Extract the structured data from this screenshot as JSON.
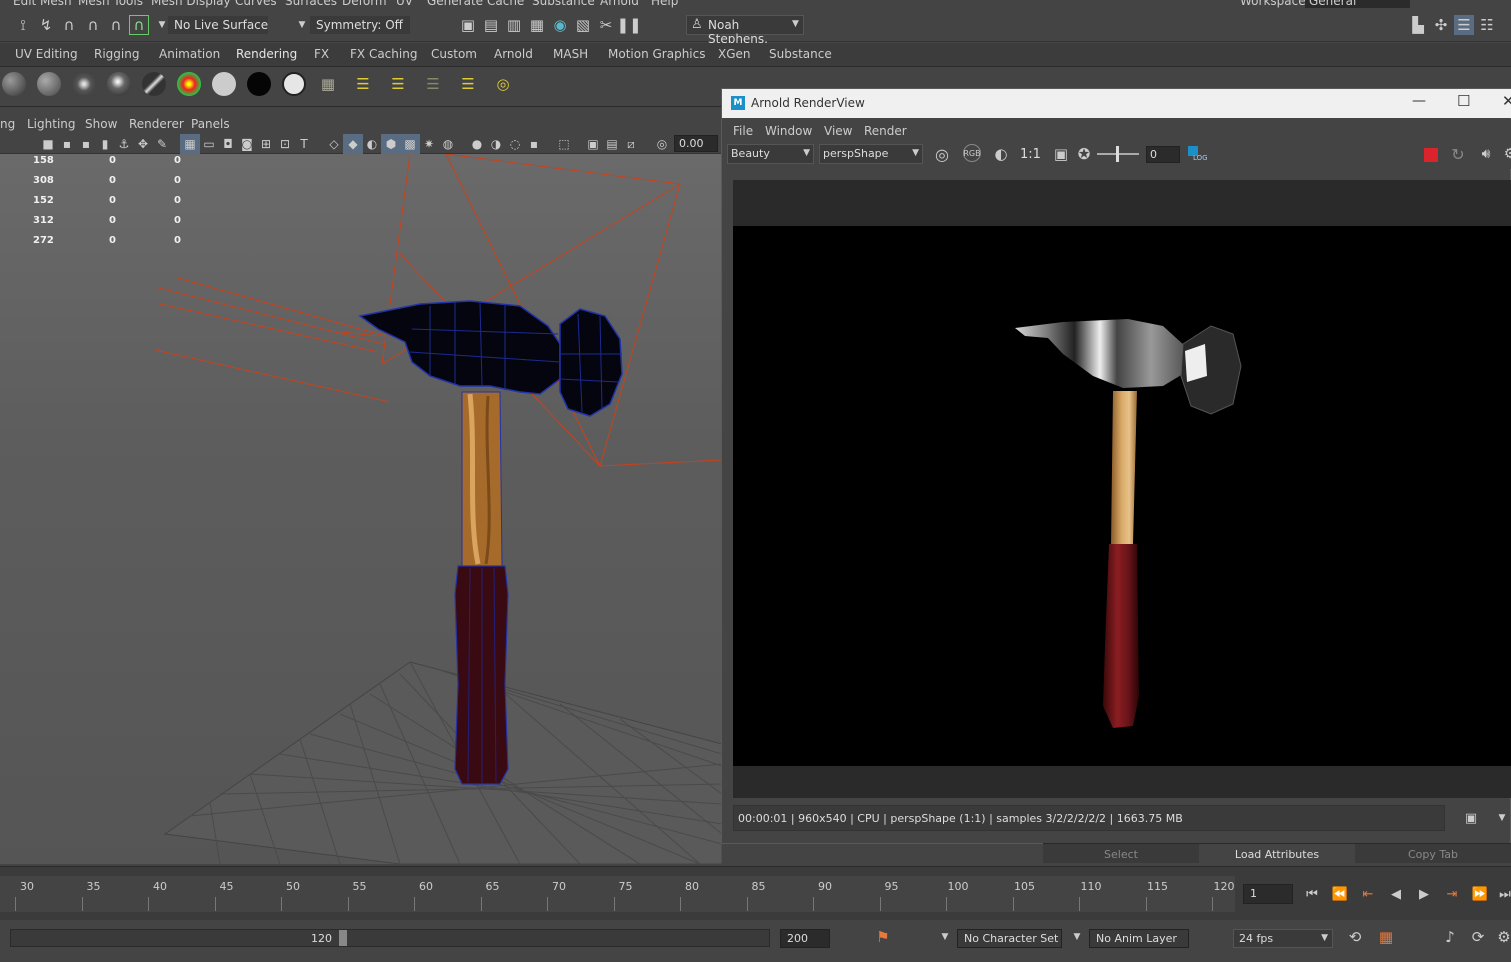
{
  "menubar": {
    "items": [
      "Edit Mesh",
      "Mesh Tools",
      "Mesh Display",
      "Curves",
      "Surfaces",
      "Deform",
      "UV",
      "Generate",
      "Cache",
      "Substance",
      "Arnold",
      "Help"
    ],
    "workspace_label": "Workspace:",
    "workspace_value": "General"
  },
  "statusline": {
    "live_surface": "No Live Surface",
    "symmetry": "Symmetry: Off",
    "user": "Noah Stephens."
  },
  "shelf": {
    "tabs": [
      "UV Editing",
      "Rigging",
      "Animation",
      "Rendering",
      "FX",
      "FX Caching",
      "Custom",
      "Arnold",
      "MASH",
      "Motion Graphics",
      "XGen",
      "Substance"
    ],
    "active_tab": "Rendering"
  },
  "panel": {
    "menus": [
      "ng",
      "Lighting",
      "Show",
      "Renderer",
      "Panels"
    ],
    "exposure_value": "0.00"
  },
  "hud_rows": [
    [
      "158",
      "0",
      "0"
    ],
    [
      "308",
      "0",
      "0"
    ],
    [
      "152",
      "0",
      "0"
    ],
    [
      "312",
      "0",
      "0"
    ],
    [
      "272",
      "0",
      "0"
    ]
  ],
  "renderview": {
    "title": "Arnold RenderView",
    "menus": [
      "File",
      "Window",
      "View",
      "Render"
    ],
    "aov": "Beauty",
    "camera": "perspShape",
    "ratio_label": "1:1",
    "exposure": "0",
    "log_label": "LOG",
    "status": "00:00:01 | 960x540 | CPU | perspShape (1:1) | samples 3/2/2/2/2/2 | 1663.75 MB",
    "stop_color": "#d9242b"
  },
  "attribute_tabs": [
    "Select",
    "Load Attributes",
    "Copy Tab"
  ],
  "timeline": {
    "ticks": [
      "30",
      "35",
      "40",
      "45",
      "50",
      "55",
      "60",
      "65",
      "70",
      "75",
      "80",
      "85",
      "90",
      "95",
      "100",
      "105",
      "110",
      "115",
      "120"
    ],
    "current_frame": "1"
  },
  "range": {
    "end_visible": "120",
    "anim_end": "200",
    "character_set": "No Character Set",
    "anim_layer": "No Anim Layer",
    "fps": "24 fps"
  }
}
